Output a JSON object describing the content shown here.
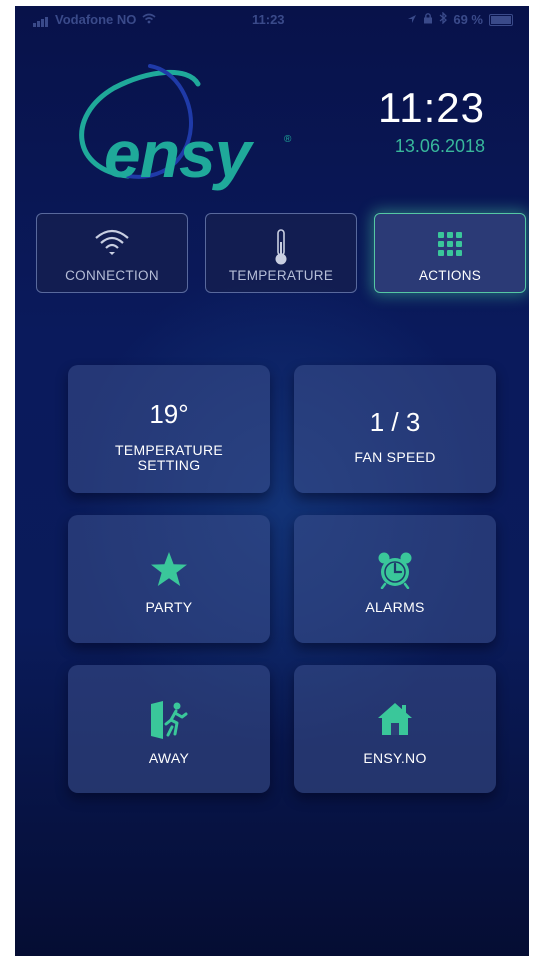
{
  "status_bar": {
    "carrier": "Vodafone NO",
    "time": "11:23",
    "battery": "69 %"
  },
  "logo": {
    "text": "ensy",
    "mark": "®"
  },
  "clock": {
    "time": "11:23",
    "date": "13.06.2018"
  },
  "tabs": [
    {
      "label": "CONNECTION",
      "icon": "wifi-icon",
      "active": false
    },
    {
      "label": "TEMPERATURE",
      "icon": "thermometer-icon",
      "active": false
    },
    {
      "label": "ACTIONS",
      "icon": "grid-icon",
      "active": true
    }
  ],
  "tiles": {
    "temperature": {
      "value": "19°",
      "label_line1": "TEMPERATURE",
      "label_line2": "SETTING"
    },
    "fan": {
      "value": "1 / 3",
      "label": "FAN SPEED"
    },
    "party": {
      "label": "PARTY",
      "icon": "star-icon"
    },
    "alarms": {
      "label": "ALARMS",
      "icon": "alarm-clock-icon"
    },
    "away": {
      "label": "AWAY",
      "icon": "exit-icon"
    },
    "ensy": {
      "label": "ENSY.NO",
      "icon": "home-icon"
    }
  },
  "colors": {
    "accent": "#38b79b",
    "background": "#0a1a5c",
    "tile": "#2f3f7a"
  }
}
